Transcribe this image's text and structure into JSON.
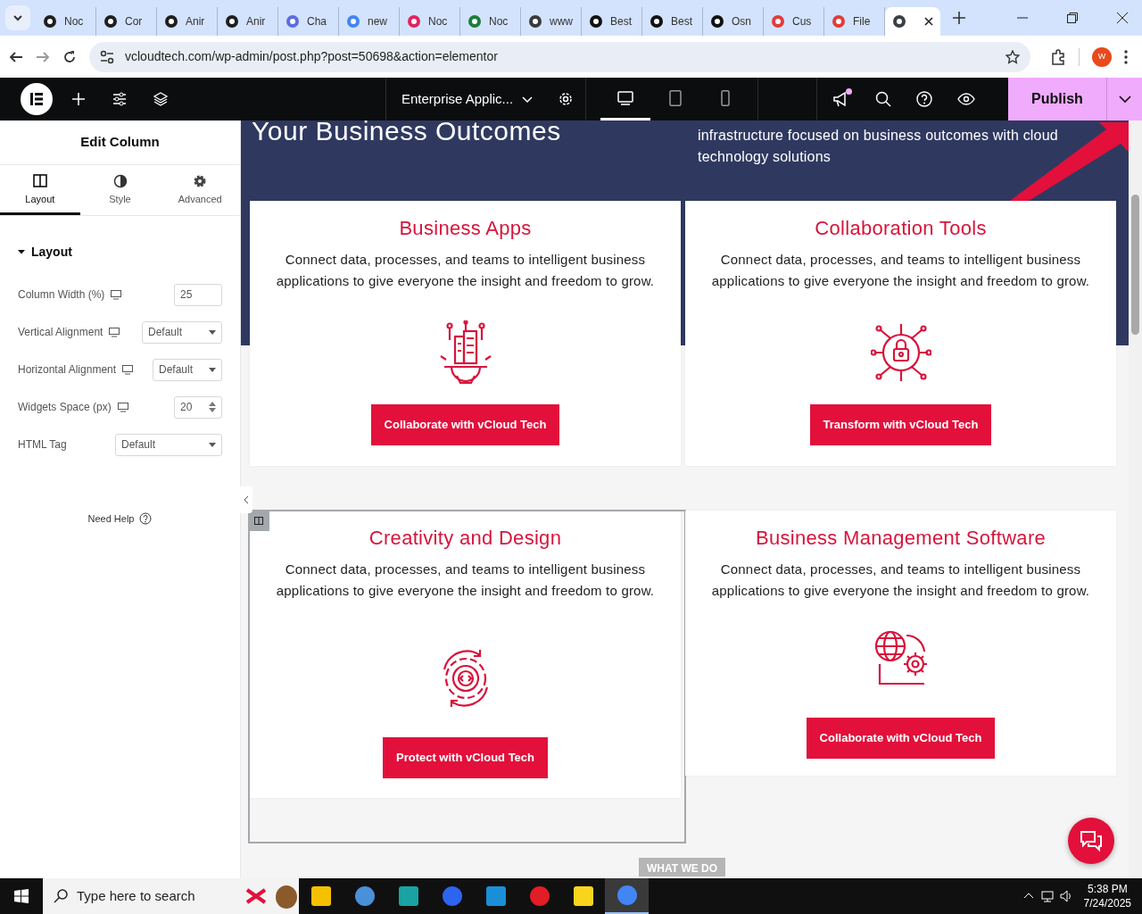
{
  "browser": {
    "tabs": [
      {
        "label": "Noc",
        "selected": false
      },
      {
        "label": "Cor",
        "selected": false
      },
      {
        "label": "Anir",
        "selected": false
      },
      {
        "label": "Anir",
        "selected": false
      },
      {
        "label": "Cha",
        "selected": false
      },
      {
        "label": "new",
        "selected": false
      },
      {
        "label": "Noc",
        "selected": false
      },
      {
        "label": "Noc",
        "selected": false
      },
      {
        "label": "www",
        "selected": false
      },
      {
        "label": "Best",
        "selected": false
      },
      {
        "label": "Best",
        "selected": false
      },
      {
        "label": "Osn",
        "selected": false
      },
      {
        "label": "Cus",
        "selected": false
      },
      {
        "label": "File",
        "selected": false
      },
      {
        "selected": true
      }
    ],
    "url": "vcloudtech.com/wp-admin/post.php?post=50698&action=elementor",
    "profile": "W"
  },
  "editor": {
    "page_title": "Enterprise Applic...",
    "devices": [
      {
        "kind": "desktop",
        "selected": true
      },
      {
        "kind": "tablet",
        "selected": false
      },
      {
        "kind": "mobile",
        "selected": false
      }
    ],
    "publish": "Publish"
  },
  "panel": {
    "title": "Edit Column",
    "tabs": [
      {
        "label": "Layout",
        "kind": "layout",
        "selected": true
      },
      {
        "label": "Style",
        "kind": "style",
        "selected": false
      },
      {
        "label": "Advanced",
        "kind": "advanced",
        "selected": false
      }
    ],
    "section": {
      "label": "Layout",
      "expanded": true
    },
    "fields": [
      {
        "label": "Column Width (%)",
        "kind": "text",
        "value": "25",
        "responsive": true
      },
      {
        "label": "Vertical Alignment",
        "kind": "select",
        "value": "Default",
        "responsive": true
      },
      {
        "label": "Horizontal Alignment",
        "kind": "select",
        "value": "Default",
        "responsive": true
      },
      {
        "label": "Widgets Space (px)",
        "kind": "number",
        "value": "20",
        "responsive": true
      },
      {
        "label": "HTML Tag",
        "kind": "select",
        "value": "Default",
        "responsive": false
      }
    ],
    "help": "Need Help"
  },
  "canvas": {
    "hero_title": "Your Business Outcomes",
    "hero_text": "infrastructure focused on business outcomes with cloud technology solutions",
    "cards": [
      {
        "title": "Business Apps",
        "text": "Connect data, processes, and teams to intelligent business applications to give everyone the insight and freedom to grow.",
        "kind": "building",
        "button": "Collaborate with vCloud Tech",
        "selected": false
      },
      {
        "title": "Collaboration Tools",
        "text": "Connect data, processes, and teams to intelligent business applications to give everyone the insight and freedom to grow.",
        "kind": "lock",
        "button": "Transform with vCloud Tech",
        "selected": false
      },
      {
        "title": "Creativity and Design",
        "text": "Connect data, processes, and teams to intelligent business applications to give everyone the insight and freedom to grow.",
        "kind": "code",
        "button": "Protect with vCloud Tech",
        "selected": true
      },
      {
        "title": "Business Management Software",
        "text": "Connect data, processes, and teams to intelligent business applications to give everyone the insight and freedom to grow.",
        "kind": "globe",
        "button": "Collaborate with vCloud Tech",
        "selected": false
      }
    ],
    "section_label": "WHAT WE DO"
  },
  "taskbar": {
    "search_placeholder": "Type here to search",
    "time": "5:38 PM",
    "date": "7/24/2025"
  }
}
